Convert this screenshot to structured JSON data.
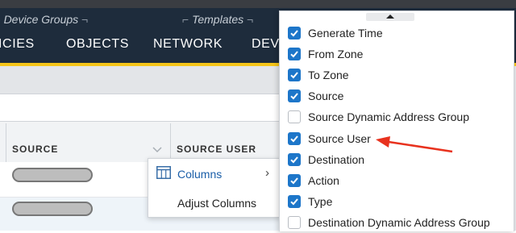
{
  "nav": {
    "group_device_groups": "Device Groups",
    "group_templates": "Templates",
    "items": [
      "ICIES",
      "OBJECTS",
      "NETWORK",
      "DEV"
    ]
  },
  "table": {
    "headers": [
      "SOURCE",
      "SOURCE USER"
    ]
  },
  "context_menu": {
    "items": [
      {
        "label": "Columns",
        "icon": "columns-icon",
        "has_submenu": true
      },
      {
        "label": "Adjust Columns"
      }
    ]
  },
  "columns_dropdown": {
    "options": [
      {
        "label": "Generate Time",
        "checked": true
      },
      {
        "label": "From Zone",
        "checked": true
      },
      {
        "label": "To Zone",
        "checked": true
      },
      {
        "label": "Source",
        "checked": true
      },
      {
        "label": "Source Dynamic Address Group",
        "checked": false
      },
      {
        "label": "Source User",
        "checked": true
      },
      {
        "label": "Destination",
        "checked": true
      },
      {
        "label": "Action",
        "checked": true
      },
      {
        "label": "Type",
        "checked": true
      },
      {
        "label": "Destination Dynamic Address Group",
        "checked": false
      }
    ]
  },
  "colors": {
    "nav_bg": "#1e2c3c",
    "accent_yellow": "#f5c518",
    "checkbox_blue": "#1d76c9",
    "link_blue": "#1a5ea8",
    "annotation_arrow": "#e8321e"
  }
}
